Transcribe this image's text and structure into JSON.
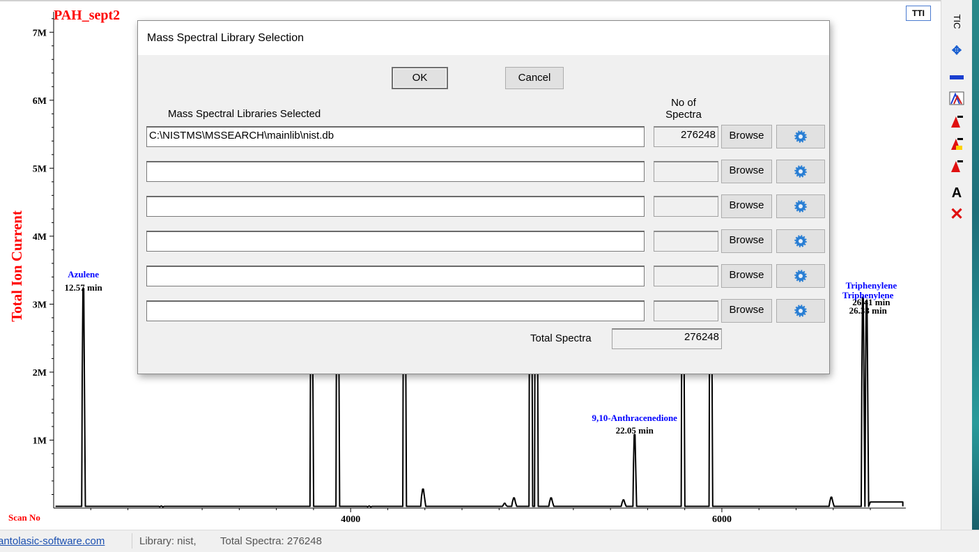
{
  "chart_data": {
    "type": "line",
    "title": "PAH_sept2",
    "xlabel": "Scan No",
    "ylabel": "Total Ion Current",
    "ylim": [
      0,
      7300000
    ],
    "xlim": [
      2400,
      6980
    ],
    "y_ticks": [
      "1M",
      "2M",
      "3M",
      "4M",
      "5M",
      "6M",
      "7M"
    ],
    "x_ticks": [
      "4000",
      "6000"
    ],
    "grid": false,
    "peaks": [
      {
        "scan": 2560,
        "height": 3230000
      },
      {
        "scan": 2980,
        "height": 30000
      },
      {
        "scan": 3790,
        "height": 3900000
      },
      {
        "scan": 3930,
        "height": 4900000
      },
      {
        "scan": 4100,
        "height": 30000
      },
      {
        "scan": 4290,
        "height": 5100000
      },
      {
        "scan": 4390,
        "height": 280000
      },
      {
        "scan": 4830,
        "height": 70000
      },
      {
        "scan": 4880,
        "height": 150000
      },
      {
        "scan": 4970,
        "height": 6200000
      },
      {
        "scan": 5000,
        "height": 6300000
      },
      {
        "scan": 5080,
        "height": 150000
      },
      {
        "scan": 5470,
        "height": 120000
      },
      {
        "scan": 5530,
        "height": 1080000
      },
      {
        "scan": 5790,
        "height": 4600000
      },
      {
        "scan": 5940,
        "height": 4800000
      },
      {
        "scan": 6590,
        "height": 160000
      },
      {
        "scan": 6760,
        "height": 3100000
      },
      {
        "scan": 6780,
        "height": 3050000
      }
    ],
    "baseline": 25000,
    "tail_level": 90000,
    "annotations": [
      {
        "name": "Azulene",
        "time": "12.57 min",
        "scan": 2560
      },
      {
        "name": "9,10-Anthracenedione",
        "time": "22.05 min",
        "scan": 5530
      },
      {
        "name": "Triphenylene",
        "time": "26.41 min",
        "scan": 6760
      },
      {
        "name": "Triphenylene",
        "time": "26.33 min",
        "scan": 6780
      }
    ]
  },
  "toolbar": {
    "tic_label": "TIC",
    "text_tool": "A",
    "top_icon": "TTI",
    "icons": [
      "move-arrows-icon",
      "horizontal-bar-icon",
      "spectrum-overlay-icon",
      "peak-label-icon",
      "peak-label-yellow-icon",
      "peak-label-small-icon",
      "text-icon",
      "delete-icon"
    ]
  },
  "dialog": {
    "title": "Mass Spectral Library Selection",
    "ok_label": "OK",
    "cancel_label": "Cancel",
    "libraries_header": "Mass Spectral Libraries Selected",
    "count_header_1": "No of",
    "count_header_2": "Spectra",
    "browse_label": "Browse",
    "libraries": [
      {
        "path": "C:\\NISTMS\\MSSEARCH\\mainlib\\nist.db",
        "count": "276248"
      },
      {
        "path": "",
        "count": ""
      },
      {
        "path": "",
        "count": ""
      },
      {
        "path": "",
        "count": ""
      },
      {
        "path": "",
        "count": ""
      },
      {
        "path": "",
        "count": ""
      }
    ],
    "total_label": "Total Spectra",
    "total_value": "276248"
  },
  "status": {
    "link": "antolasic-software.com",
    "library": "Library: nist,",
    "total": "Total Spectra: 276248"
  },
  "colors": {
    "title_red": "#ff0000",
    "annotation_blue": "#0000ff",
    "gear_blue": "#2a7fd4"
  }
}
